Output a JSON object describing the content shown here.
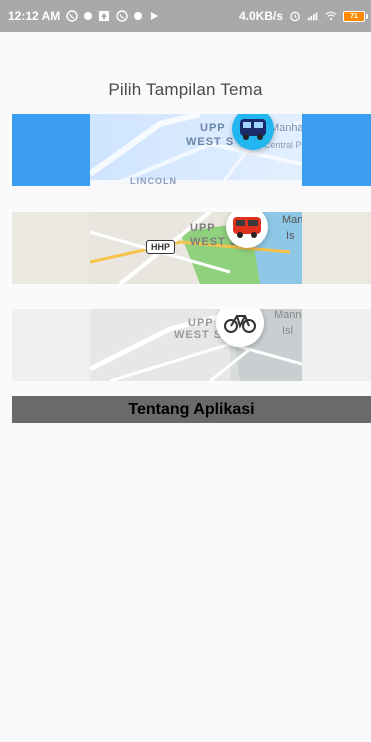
{
  "status_bar": {
    "time": "12:12 AM",
    "net_speed": "4.0KB/s",
    "battery_level": "71",
    "icons": [
      "whatsapp-icon",
      "notification-dot-icon",
      "upload-icon",
      "whatsapp-icon",
      "notification-dot-icon",
      "play-icon",
      "alarm-icon",
      "signal-icon",
      "wifi-icon",
      "battery-icon"
    ]
  },
  "header": {
    "title": "Pilih Tampilan Tema"
  },
  "themes": [
    {
      "name": "blue",
      "map_labels": [
        "UPP",
        "WEST S",
        "Manha",
        "Central P",
        "LINCOLN"
      ],
      "icon": "bus-icon",
      "accent": "#3a9df0"
    },
    {
      "name": "color",
      "map_labels": [
        "UPP",
        "WEST S",
        "Man",
        "Is",
        "HHP"
      ],
      "icon": "bus-red-icon",
      "accent": "#ebe8e1"
    },
    {
      "name": "gray",
      "map_labels": [
        "UPP",
        "WEST S",
        "Mann",
        "Isl"
      ],
      "icon": "bicycle-icon",
      "accent": "#eef0ef"
    }
  ],
  "section": {
    "about_label": "Tentang Aplikasi"
  }
}
